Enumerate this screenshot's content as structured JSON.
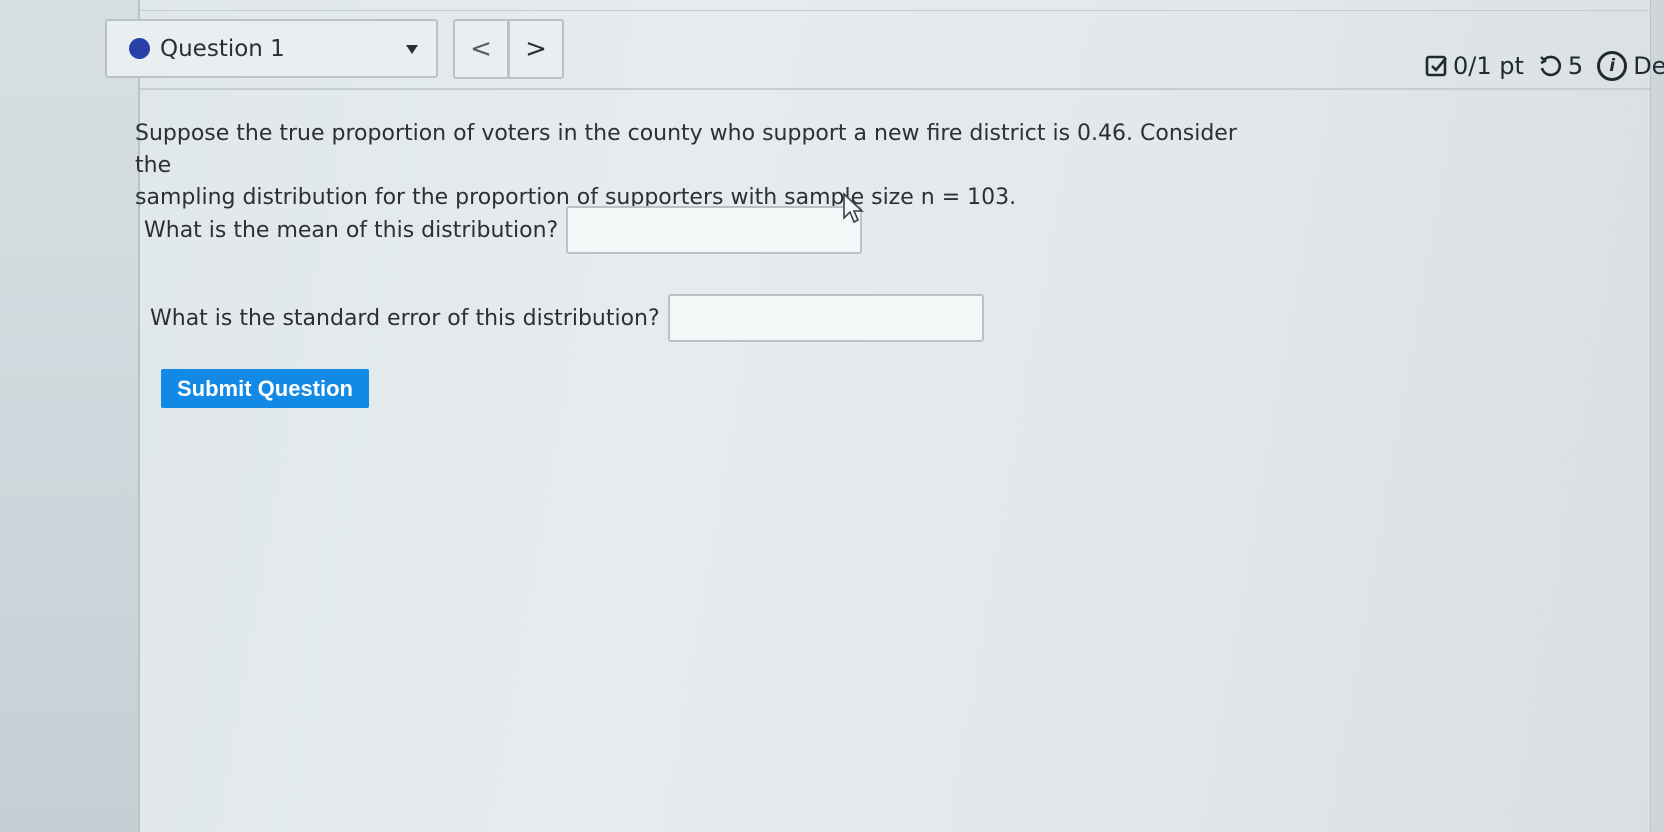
{
  "header": {
    "question_selector": {
      "label": "Question 1",
      "status_dot_color": "#2741a8"
    },
    "nav": {
      "prev_label": "<",
      "next_label": ">"
    },
    "status": {
      "score": "0/1 pt",
      "retries": "5",
      "details_label": "De",
      "icons": [
        "checkbox-icon",
        "retry-icon",
        "info-icon"
      ]
    }
  },
  "question": {
    "prompt_line1": "Suppose the true proportion of voters in the county who support a new fire district is 0.46. Consider the",
    "prompt_line2": "sampling distribution for the proportion of supporters with sample size n = 103.",
    "items": [
      {
        "label": "What is the mean of this distribution?",
        "value": ""
      },
      {
        "label": "What is the standard error of this distribution?",
        "value": ""
      }
    ],
    "submit_label": "Submit Question"
  },
  "colors": {
    "submit_button": "#1389e6",
    "status_dot": "#2741a8"
  }
}
